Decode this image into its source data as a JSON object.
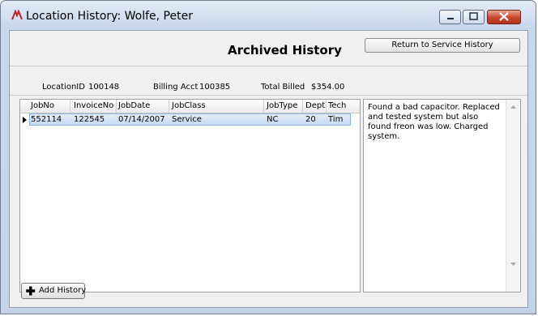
{
  "window": {
    "title": "Location History: Wolfe, Peter"
  },
  "header": {
    "title": "Archived History",
    "return_button": "Return to Service History"
  },
  "info": {
    "location_label": "LocationID",
    "location_value": "100148",
    "billing_label": "Billing Acct",
    "billing_value": "100385",
    "total_label": "Total Billed",
    "total_value": "$354.00"
  },
  "table": {
    "columns": [
      "JobNo",
      "InvoiceNo",
      "JobDate",
      "JobClass",
      "JobType",
      "Dept",
      "Tech"
    ],
    "rows": [
      [
        "552114",
        "122545",
        "07/14/2007",
        "Service",
        "NC",
        "20",
        "Tim"
      ]
    ]
  },
  "notes": {
    "text": "Found a bad capacitor. Replaced and tested system but also found freon was low. Charged system."
  },
  "footer": {
    "add_button": "Add History"
  }
}
